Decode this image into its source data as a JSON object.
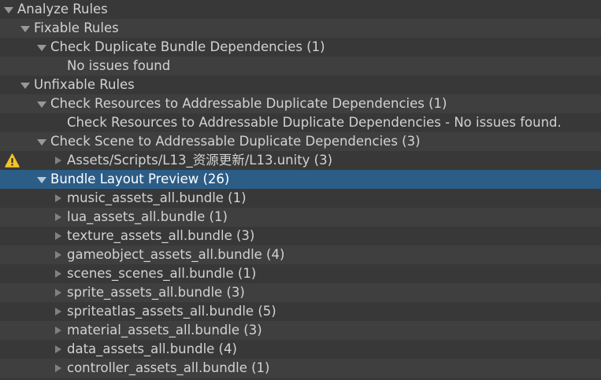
{
  "tree": {
    "rows": [
      {
        "label": "Analyze Rules",
        "level": 0,
        "arrow": "expanded"
      },
      {
        "label": "Fixable Rules",
        "level": 1,
        "arrow": "expanded"
      },
      {
        "label": "Check Duplicate Bundle Dependencies (1)",
        "level": 2,
        "arrow": "expanded"
      },
      {
        "label": "No issues found",
        "level": 3,
        "arrow": "none"
      },
      {
        "label": "Unfixable Rules",
        "level": 1,
        "arrow": "expanded"
      },
      {
        "label": "Check Resources to Addressable Duplicate Dependencies (1)",
        "level": 2,
        "arrow": "expanded"
      },
      {
        "label": "Check Resources to Addressable Duplicate Dependencies - No issues found.",
        "level": 3,
        "arrow": "none"
      },
      {
        "label": "Check Scene to Addressable Duplicate Dependencies (3)",
        "level": 2,
        "arrow": "expanded"
      },
      {
        "label": "Assets/Scripts/L13_资源更新/L13.unity (3)",
        "level": 3,
        "arrow": "collapsed",
        "icon": "warning-icon"
      },
      {
        "label": "Bundle Layout Preview (26)",
        "level": 2,
        "arrow": "expanded",
        "selected": true
      },
      {
        "label": "music_assets_all.bundle (1)",
        "level": 3,
        "arrow": "collapsed"
      },
      {
        "label": "lua_assets_all.bundle (1)",
        "level": 3,
        "arrow": "collapsed"
      },
      {
        "label": "texture_assets_all.bundle (3)",
        "level": 3,
        "arrow": "collapsed"
      },
      {
        "label": "gameobject_assets_all.bundle (4)",
        "level": 3,
        "arrow": "collapsed"
      },
      {
        "label": "scenes_scenes_all.bundle (1)",
        "level": 3,
        "arrow": "collapsed"
      },
      {
        "label": "sprite_assets_all.bundle (3)",
        "level": 3,
        "arrow": "collapsed"
      },
      {
        "label": "spriteatlas_assets_all.bundle (5)",
        "level": 3,
        "arrow": "collapsed"
      },
      {
        "label": "material_assets_all.bundle (3)",
        "level": 3,
        "arrow": "collapsed"
      },
      {
        "label": "data_assets_all.bundle (4)",
        "level": 3,
        "arrow": "collapsed"
      },
      {
        "label": "controller_assets_all.bundle (1)",
        "level": 3,
        "arrow": "collapsed"
      }
    ]
  },
  "colors": {
    "background": "#383838",
    "alternate_row": "#3f3f3f",
    "selection": "#2c5d87",
    "text": "#d2d2d2",
    "warning": "#f4c327"
  }
}
